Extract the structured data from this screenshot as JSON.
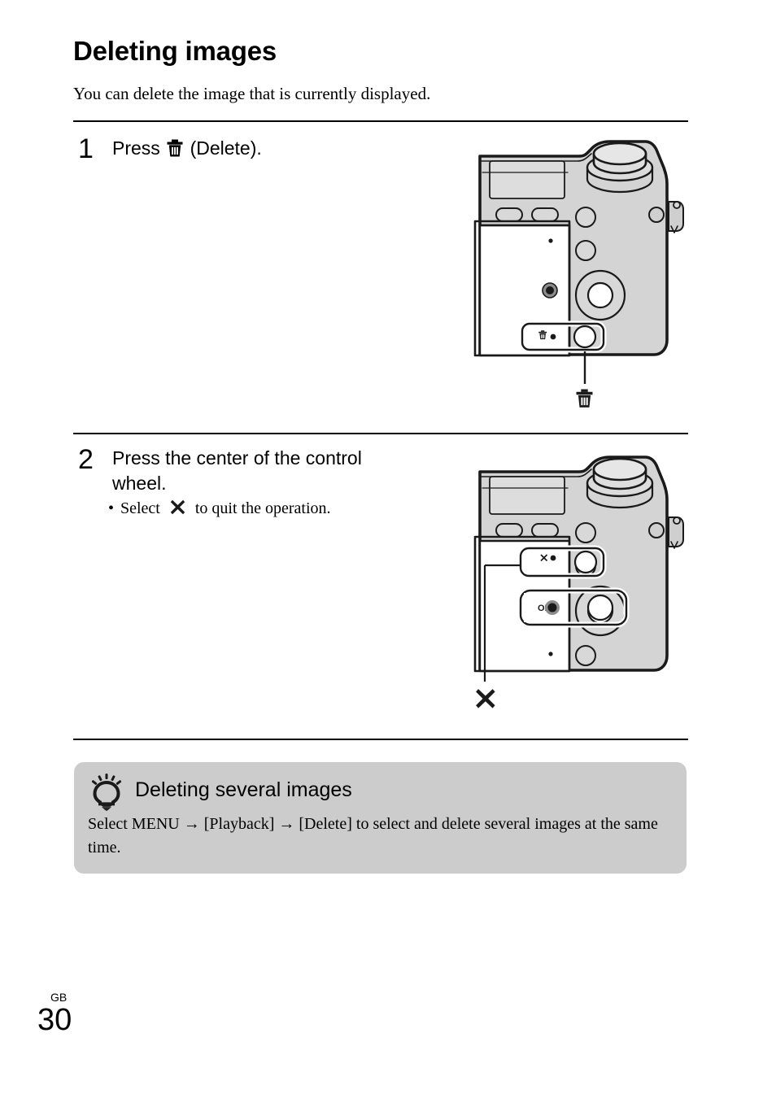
{
  "document": {
    "title": "Deleting images",
    "intro": "You can delete the image that is currently displayed."
  },
  "steps": [
    {
      "number": "1",
      "text_before_icon": "Press",
      "icon": "trash-icon",
      "text_after_icon": "(Delete).",
      "figure": {
        "name": "camera-rear-delete-button",
        "callout_icon": "trash-icon",
        "button_label_icon": "trash-icon"
      }
    },
    {
      "number": "2",
      "line1": "Press the center of the control",
      "line2": "wheel.",
      "bullet_before_icon": "Select",
      "bullet_icon": "cross-icon",
      "bullet_after_icon": "to quit the operation.",
      "figure": {
        "name": "camera-rear-control-wheel",
        "callout_icon": "cross-icon",
        "screen_labels": [
          "×",
          "OK"
        ]
      }
    }
  ],
  "tip": {
    "icon": "lightbulb-icon",
    "heading": "Deleting several images",
    "body": "Select MENU → [Playback] → [Delete] to select and delete several images at the same time."
  },
  "footer": {
    "region": "GB",
    "page_number": "30"
  },
  "colors": {
    "tip_background": "#cccccc",
    "camera_body": "#d4d4d4",
    "camera_outline": "#1a1a1a",
    "screen": "#ffffff",
    "text": "#000000"
  }
}
